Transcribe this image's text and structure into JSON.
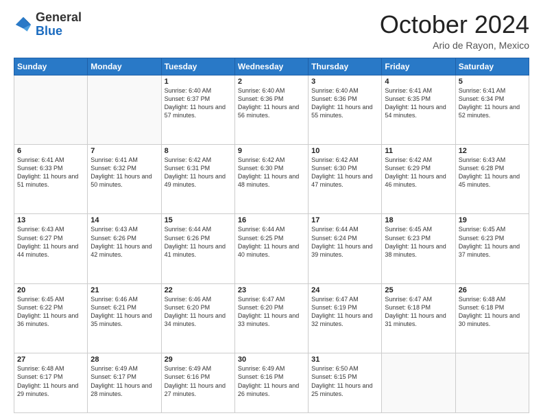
{
  "header": {
    "logo_general": "General",
    "logo_blue": "Blue",
    "month_title": "October 2024",
    "location": "Ario de Rayon, Mexico"
  },
  "days_of_week": [
    "Sunday",
    "Monday",
    "Tuesday",
    "Wednesday",
    "Thursday",
    "Friday",
    "Saturday"
  ],
  "weeks": [
    [
      {
        "day": "",
        "text": ""
      },
      {
        "day": "",
        "text": ""
      },
      {
        "day": "1",
        "text": "Sunrise: 6:40 AM\nSunset: 6:37 PM\nDaylight: 11 hours and 57 minutes."
      },
      {
        "day": "2",
        "text": "Sunrise: 6:40 AM\nSunset: 6:36 PM\nDaylight: 11 hours and 56 minutes."
      },
      {
        "day": "3",
        "text": "Sunrise: 6:40 AM\nSunset: 6:36 PM\nDaylight: 11 hours and 55 minutes."
      },
      {
        "day": "4",
        "text": "Sunrise: 6:41 AM\nSunset: 6:35 PM\nDaylight: 11 hours and 54 minutes."
      },
      {
        "day": "5",
        "text": "Sunrise: 6:41 AM\nSunset: 6:34 PM\nDaylight: 11 hours and 52 minutes."
      }
    ],
    [
      {
        "day": "6",
        "text": "Sunrise: 6:41 AM\nSunset: 6:33 PM\nDaylight: 11 hours and 51 minutes."
      },
      {
        "day": "7",
        "text": "Sunrise: 6:41 AM\nSunset: 6:32 PM\nDaylight: 11 hours and 50 minutes."
      },
      {
        "day": "8",
        "text": "Sunrise: 6:42 AM\nSunset: 6:31 PM\nDaylight: 11 hours and 49 minutes."
      },
      {
        "day": "9",
        "text": "Sunrise: 6:42 AM\nSunset: 6:30 PM\nDaylight: 11 hours and 48 minutes."
      },
      {
        "day": "10",
        "text": "Sunrise: 6:42 AM\nSunset: 6:30 PM\nDaylight: 11 hours and 47 minutes."
      },
      {
        "day": "11",
        "text": "Sunrise: 6:42 AM\nSunset: 6:29 PM\nDaylight: 11 hours and 46 minutes."
      },
      {
        "day": "12",
        "text": "Sunrise: 6:43 AM\nSunset: 6:28 PM\nDaylight: 11 hours and 45 minutes."
      }
    ],
    [
      {
        "day": "13",
        "text": "Sunrise: 6:43 AM\nSunset: 6:27 PM\nDaylight: 11 hours and 44 minutes."
      },
      {
        "day": "14",
        "text": "Sunrise: 6:43 AM\nSunset: 6:26 PM\nDaylight: 11 hours and 42 minutes."
      },
      {
        "day": "15",
        "text": "Sunrise: 6:44 AM\nSunset: 6:26 PM\nDaylight: 11 hours and 41 minutes."
      },
      {
        "day": "16",
        "text": "Sunrise: 6:44 AM\nSunset: 6:25 PM\nDaylight: 11 hours and 40 minutes."
      },
      {
        "day": "17",
        "text": "Sunrise: 6:44 AM\nSunset: 6:24 PM\nDaylight: 11 hours and 39 minutes."
      },
      {
        "day": "18",
        "text": "Sunrise: 6:45 AM\nSunset: 6:23 PM\nDaylight: 11 hours and 38 minutes."
      },
      {
        "day": "19",
        "text": "Sunrise: 6:45 AM\nSunset: 6:23 PM\nDaylight: 11 hours and 37 minutes."
      }
    ],
    [
      {
        "day": "20",
        "text": "Sunrise: 6:45 AM\nSunset: 6:22 PM\nDaylight: 11 hours and 36 minutes."
      },
      {
        "day": "21",
        "text": "Sunrise: 6:46 AM\nSunset: 6:21 PM\nDaylight: 11 hours and 35 minutes."
      },
      {
        "day": "22",
        "text": "Sunrise: 6:46 AM\nSunset: 6:20 PM\nDaylight: 11 hours and 34 minutes."
      },
      {
        "day": "23",
        "text": "Sunrise: 6:47 AM\nSunset: 6:20 PM\nDaylight: 11 hours and 33 minutes."
      },
      {
        "day": "24",
        "text": "Sunrise: 6:47 AM\nSunset: 6:19 PM\nDaylight: 11 hours and 32 minutes."
      },
      {
        "day": "25",
        "text": "Sunrise: 6:47 AM\nSunset: 6:18 PM\nDaylight: 11 hours and 31 minutes."
      },
      {
        "day": "26",
        "text": "Sunrise: 6:48 AM\nSunset: 6:18 PM\nDaylight: 11 hours and 30 minutes."
      }
    ],
    [
      {
        "day": "27",
        "text": "Sunrise: 6:48 AM\nSunset: 6:17 PM\nDaylight: 11 hours and 29 minutes."
      },
      {
        "day": "28",
        "text": "Sunrise: 6:49 AM\nSunset: 6:17 PM\nDaylight: 11 hours and 28 minutes."
      },
      {
        "day": "29",
        "text": "Sunrise: 6:49 AM\nSunset: 6:16 PM\nDaylight: 11 hours and 27 minutes."
      },
      {
        "day": "30",
        "text": "Sunrise: 6:49 AM\nSunset: 6:16 PM\nDaylight: 11 hours and 26 minutes."
      },
      {
        "day": "31",
        "text": "Sunrise: 6:50 AM\nSunset: 6:15 PM\nDaylight: 11 hours and 25 minutes."
      },
      {
        "day": "",
        "text": ""
      },
      {
        "day": "",
        "text": ""
      }
    ]
  ]
}
